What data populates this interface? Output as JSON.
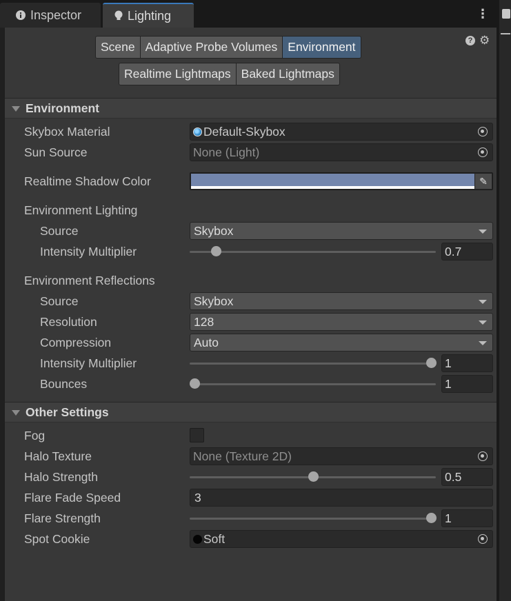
{
  "tabs": {
    "inspector": "Inspector",
    "lighting": "Lighting"
  },
  "toolbar": {
    "row1": [
      "Scene",
      "Adaptive Probe Volumes",
      "Environment"
    ],
    "row2": [
      "Realtime Lightmaps",
      "Baked Lightmaps"
    ],
    "active": "Environment",
    "help_icon": "?",
    "settings_icon": "gear-icon"
  },
  "environment": {
    "header": "Environment",
    "skybox_material": {
      "label": "Skybox Material",
      "value": "Default-Skybox"
    },
    "sun_source": {
      "label": "Sun Source",
      "value": "None (Light)"
    },
    "realtime_shadow_color": {
      "label": "Realtime Shadow Color",
      "color": "#7386ad"
    },
    "lighting": {
      "label": "Environment Lighting",
      "source": {
        "label": "Source",
        "value": "Skybox"
      },
      "intensity": {
        "label": "Intensity Multiplier",
        "value": "0.7",
        "fraction": 0.09
      }
    },
    "reflections": {
      "label": "Environment Reflections",
      "source": {
        "label": "Source",
        "value": "Skybox"
      },
      "resolution": {
        "label": "Resolution",
        "value": "128"
      },
      "compression": {
        "label": "Compression",
        "value": "Auto"
      },
      "intensity": {
        "label": "Intensity Multiplier",
        "value": "1",
        "fraction": 1.0
      },
      "bounces": {
        "label": "Bounces",
        "value": "1",
        "fraction": 0.0
      }
    }
  },
  "other": {
    "header": "Other Settings",
    "fog": {
      "label": "Fog",
      "checked": false
    },
    "halo_texture": {
      "label": "Halo Texture",
      "value": "None (Texture 2D)"
    },
    "halo_strength": {
      "label": "Halo Strength",
      "value": "0.5",
      "fraction": 0.5
    },
    "flare_fade_speed": {
      "label": "Flare Fade Speed",
      "value": "3"
    },
    "flare_strength": {
      "label": "Flare Strength",
      "value": "1",
      "fraction": 1.0
    },
    "spot_cookie": {
      "label": "Spot Cookie",
      "value": "Soft"
    }
  }
}
